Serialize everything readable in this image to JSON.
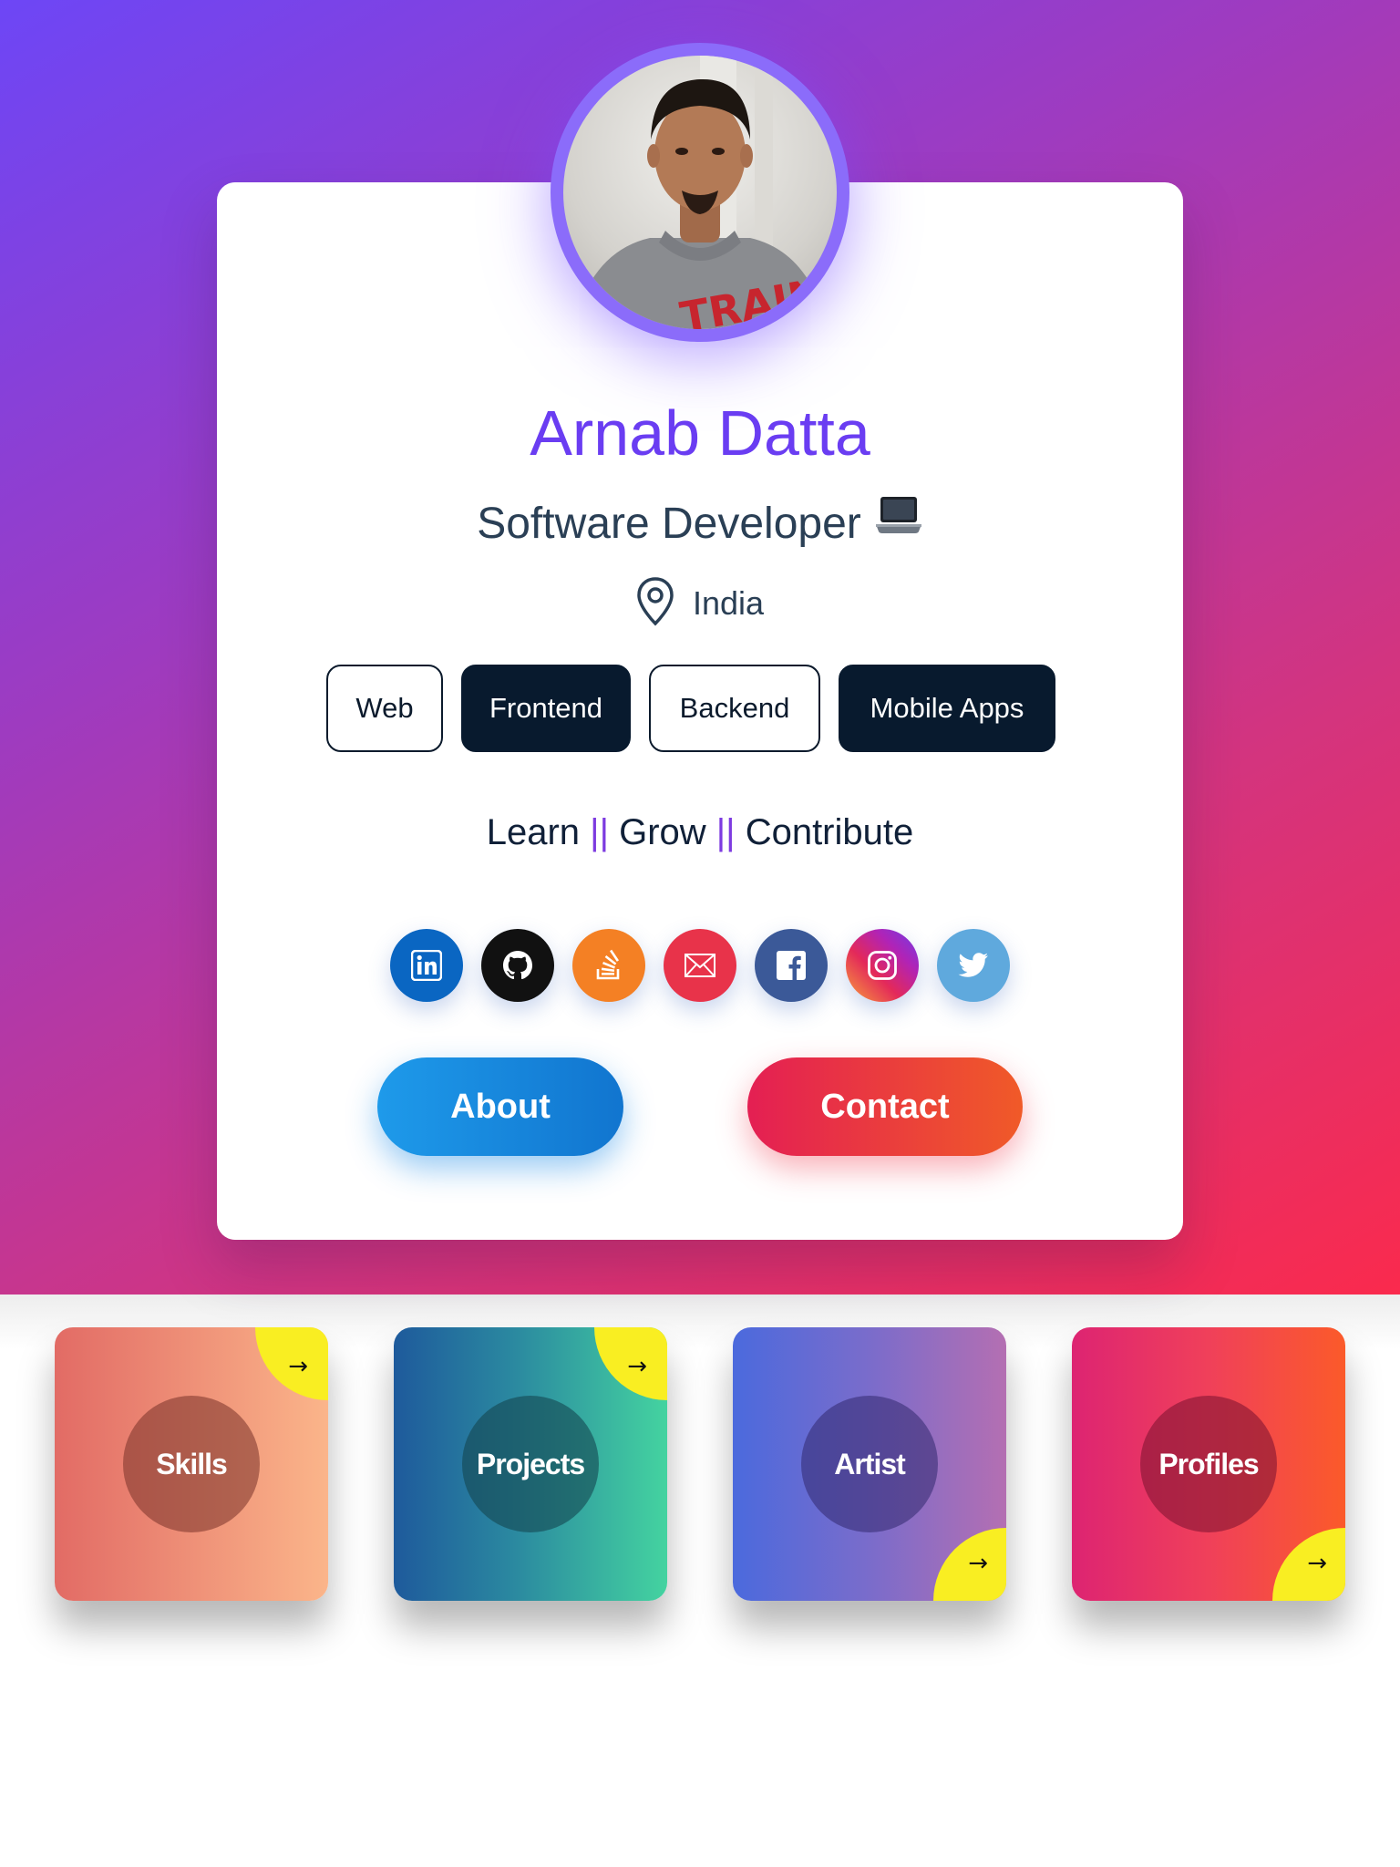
{
  "profile": {
    "name": "Arnab Datta",
    "role": "Software Developer",
    "role_emoji": "laptop-icon",
    "location": "India",
    "avatar_shirt_text": "TRAIN"
  },
  "tags": [
    {
      "label": "Web",
      "style": "outline"
    },
    {
      "label": "Frontend",
      "style": "filled"
    },
    {
      "label": "Backend",
      "style": "outline"
    },
    {
      "label": "Mobile Apps",
      "style": "filled"
    }
  ],
  "motto": {
    "parts": [
      "Learn",
      "Grow",
      "Contribute"
    ],
    "separator": "||"
  },
  "social": [
    {
      "name": "linkedin-icon",
      "color": "#0a66c2"
    },
    {
      "name": "github-icon",
      "color": "#111111"
    },
    {
      "name": "stackoverflow-icon",
      "color": "#f48024"
    },
    {
      "name": "email-icon",
      "color": "#e8334a"
    },
    {
      "name": "facebook-icon",
      "color": "#3b5998"
    },
    {
      "name": "instagram-icon",
      "color": "#c13584"
    },
    {
      "name": "twitter-icon",
      "color": "#5fa9dd"
    }
  ],
  "buttons": {
    "about": "About",
    "contact": "Contact"
  },
  "tiles": [
    {
      "label": "Skills",
      "arrow": "→",
      "arrow_corner": "top-right"
    },
    {
      "label": "Projects",
      "arrow": "→",
      "arrow_corner": "top-right"
    },
    {
      "label": "Artist",
      "arrow": "→",
      "arrow_corner": "bottom-right"
    },
    {
      "label": "Profiles",
      "arrow": "→",
      "arrow_corner": "bottom-right"
    }
  ],
  "colors": {
    "accent": "#6a3df2",
    "text_dark": "#2a3f55",
    "tag_dark": "#081a2e",
    "tile_corner": "#f9ee22"
  }
}
